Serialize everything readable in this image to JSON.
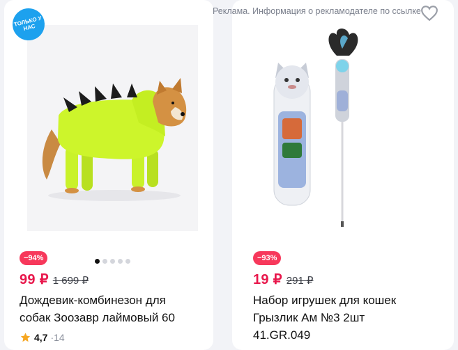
{
  "ad_notice": "Реклама. Информация о рекламодателе по ссылке",
  "products": [
    {
      "badge": "ТОЛЬКО У НАС",
      "discount": "−94%",
      "price": "99 ₽",
      "old_price": "1 699 ₽",
      "title_line1": "Дождевик-комбинезон для",
      "title_line2": "собак Зоозавр лаймовый 60",
      "rating": "4,7",
      "reviews": "·14",
      "image_dots": 5,
      "active_dot": 0
    },
    {
      "discount": "−93%",
      "price": "19 ₽",
      "old_price": "291 ₽",
      "title_line1": "Набор игрушек для кошек",
      "title_line2": "Грызлик Ам №3 2шт",
      "title_line3": "41.GR.049"
    }
  ],
  "colors": {
    "price": "#e8174b",
    "discount_bg": "#f7385b",
    "badge_bg": "#1da1ee",
    "star": "#f6a723"
  }
}
